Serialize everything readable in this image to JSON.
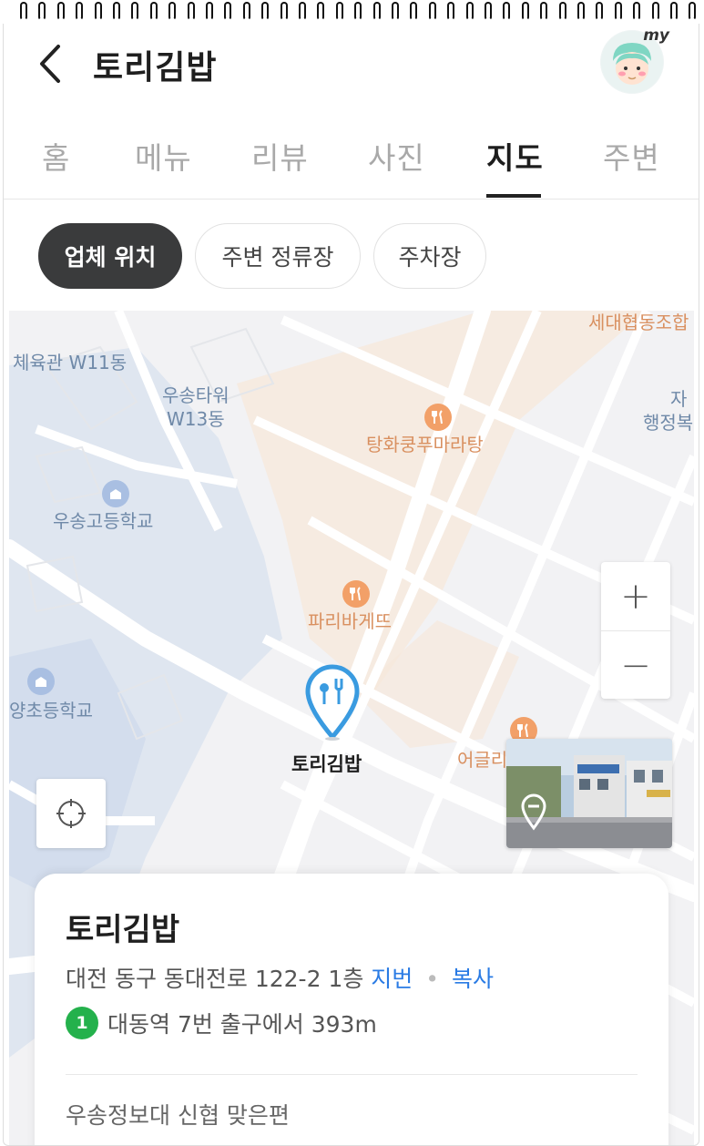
{
  "header": {
    "title": "토리김밥",
    "avatar_text": "my"
  },
  "tabs": [
    {
      "label": "홈",
      "active": false
    },
    {
      "label": "메뉴",
      "active": false
    },
    {
      "label": "리뷰",
      "active": false
    },
    {
      "label": "사진",
      "active": false
    },
    {
      "label": "지도",
      "active": true
    },
    {
      "label": "주변",
      "active": false
    }
  ],
  "chips": [
    {
      "label": "업체 위치",
      "active": true
    },
    {
      "label": "주변 정류장",
      "active": false
    },
    {
      "label": "주차장",
      "active": false
    }
  ],
  "map": {
    "labels": {
      "gym": "체육관 W11동",
      "tower_1": "우송타워",
      "tower_2": "W13동",
      "restaurant_1": "탕화쿵푸마라탕",
      "admin_1": "자",
      "admin_2": "행정복",
      "highschool": "우송고등학교",
      "bakery": "파리바게뜨",
      "elementary": "양초등학교",
      "store_pin": "토리김밥",
      "restaurant_2": "어글리",
      "top_cut": "세대협동조합"
    },
    "zoom_in": "+",
    "zoom_out": "−"
  },
  "card": {
    "title": "토리김밥",
    "address": "대전 동구 동대전로 122-2 1층",
    "jibun_link": "지번",
    "separator": "•",
    "copy_link": "복사",
    "line_number": "1",
    "station_text": "대동역 7번 출구에서 393m",
    "note": "우송정보대 신협 맞은편"
  },
  "colors": {
    "accent_link": "#2a7be4",
    "pin_blue": "#3a9be0",
    "chip_active": "#3a3b3c",
    "line1_green": "#24b14c",
    "food_poi": "#f2a068"
  }
}
